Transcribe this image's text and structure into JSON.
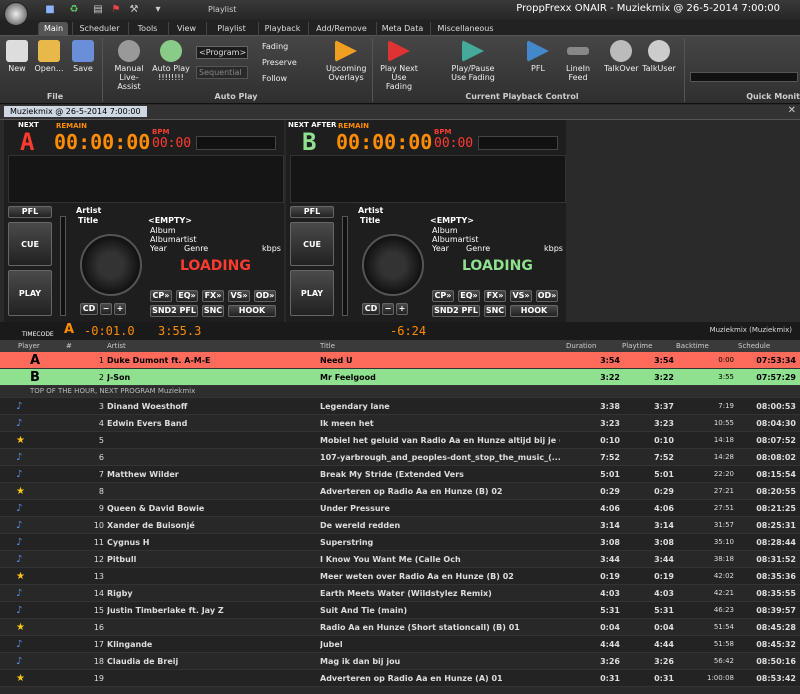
{
  "window": {
    "title": "ProppFrexx ONAIR - Muziekmix @ 26-5-2014 7:00:00",
    "context": "Playlist"
  },
  "tabs": [
    "Main",
    "Scheduler",
    "Tools",
    "View",
    "Playlist",
    "Playback",
    "Add/Remove",
    "Meta Data",
    "Miscellaneous"
  ],
  "ribbon": {
    "file": {
      "new": "New",
      "open": "Open...",
      "save": "Save",
      "group": "File"
    },
    "autoplay": {
      "manual": "Manual Live-Assist",
      "auto": "Auto Play !!!!!!!!",
      "program": "<Program>",
      "sequential": "Sequential",
      "fading": "Fading",
      "preserve": "Preserve",
      "follow": "Follow",
      "upcoming": "Upcoming Overlays",
      "group": "Auto Play"
    },
    "control": {
      "playnext": "Play Next Use Fading",
      "playpause": "Play/Pause Use Fading",
      "pfl": "PFL",
      "linein": "LineIn Feed",
      "talkover": "TalkOver",
      "talkuser": "TalkUser",
      "group": "Current Playback Control"
    },
    "quick": "Quick Monit"
  },
  "doctab": "Muziekmix @ 26-5-2014 7:00:00",
  "decks": [
    {
      "tag": "NEXT",
      "letter": "A",
      "remain": "REMAIN",
      "bpm": "BPM",
      "time": "00:00:00",
      "time2": "00:00",
      "pfl": "PFL",
      "cue": "CUE",
      "play": "PLAY",
      "artist": "Artist",
      "title": "Title",
      "empty": "<EMPTY>",
      "album": "Album",
      "albumartist": "Albumartist",
      "year": "Year",
      "genre": "Genre",
      "kbps": "kbps",
      "status": "LOADING",
      "cd": "CD",
      "pos": "-0:01.0",
      "len": "3:55.3",
      "cp": "CP»",
      "eq": "EQ»",
      "fx": "FX»",
      "vs": "VS»",
      "od": "OD»",
      "snd2": "SND2 PFL",
      "snc": "SNC",
      "hook": "HOOK"
    },
    {
      "tag": "NEXT AFTER",
      "letter": "B",
      "remain": "REMAIN",
      "bpm": "BPM",
      "time": "00:00:00",
      "time2": "00:00",
      "pfl": "PFL",
      "cue": "CUE",
      "play": "PLAY",
      "artist": "Artist",
      "title": "Title",
      "empty": "<EMPTY>",
      "album": "Album",
      "albumartist": "Albumartist",
      "year": "Year",
      "genre": "Genre",
      "kbps": "kbps",
      "status": "LOADING",
      "cd": "CD",
      "pos": "-6:24",
      "cp": "CP»",
      "eq": "EQ»",
      "fx": "FX»",
      "vs": "VS»",
      "od": "OD»",
      "snd2": "SND2 PFL",
      "snc": "SNC",
      "hook": "HOOK"
    }
  ],
  "timecode": "TIMECODE",
  "timecode_letter": "A",
  "playlist_name": "Muziekmix (Muziekmix)",
  "headers": {
    "player": "Player",
    "num": "#",
    "artist": "Artist",
    "title": "Title",
    "duration": "Duration",
    "playtime": "Playtime",
    "backtime": "Backtime",
    "schedule": "Schedule"
  },
  "colors": {
    "deckA": "#ff6b5a",
    "deckB": "#8fe08f",
    "orange": "#ff8c00",
    "red": "#ff3b2f"
  },
  "rows": [
    {
      "player": "A",
      "num": "1",
      "artist": "Duke Dumont ft. A-M-E",
      "title": "Need U",
      "dur": "3:54",
      "play": "3:54",
      "back": "0:00",
      "sched": "07:53:34",
      "type": "a"
    },
    {
      "player": "B",
      "num": "2",
      "artist": "J-Son",
      "title": "Mr Feelgood",
      "dur": "3:22",
      "play": "3:22",
      "back": "3:55",
      "sched": "07:57:29",
      "type": "b"
    },
    {
      "sub": "TOP OF THE HOUR,  NEXT PROGRAM Muziekmix"
    },
    {
      "icon": "note",
      "num": "3",
      "artist": "Dinand Woesthoff",
      "title": "Legendary lane",
      "dur": "3:38",
      "play": "3:37",
      "back": "7:19",
      "sched": "08:00:53"
    },
    {
      "icon": "note",
      "num": "4",
      "artist": "Edwin Evers Band",
      "title": "Ik meen het",
      "dur": "3:23",
      "play": "3:23",
      "back": "10:55",
      "sched": "08:04:30"
    },
    {
      "icon": "star",
      "num": "5",
      "artist": "",
      "title": "Mobiel het geluid van Radio Aa en Hunze altijd bij je (A...",
      "dur": "0:10",
      "play": "0:10",
      "back": "14:18",
      "sched": "08:07:52"
    },
    {
      "icon": "note",
      "num": "6",
      "artist": "",
      "title": "107-yarbrough_and_peoples-dont_stop_the_music_(...",
      "dur": "7:52",
      "play": "7:52",
      "back": "14:28",
      "sched": "08:08:02"
    },
    {
      "icon": "note",
      "num": "7",
      "artist": "Matthew Wilder",
      "title": "Break My Stride (Extended Vers",
      "dur": "5:01",
      "play": "5:01",
      "back": "22:20",
      "sched": "08:15:54"
    },
    {
      "icon": "star",
      "num": "8",
      "artist": "",
      "title": "Adverteren op Radio Aa en Hunze (B) 02",
      "dur": "0:29",
      "play": "0:29",
      "back": "27:21",
      "sched": "08:20:55"
    },
    {
      "icon": "note",
      "num": "9",
      "artist": "Queen & David Bowie",
      "title": "Under Pressure",
      "dur": "4:06",
      "play": "4:06",
      "back": "27:51",
      "sched": "08:21:25"
    },
    {
      "icon": "note",
      "num": "10",
      "artist": "Xander de Buisonjé",
      "title": "De wereld redden",
      "dur": "3:14",
      "play": "3:14",
      "back": "31:57",
      "sched": "08:25:31"
    },
    {
      "icon": "note",
      "num": "11",
      "artist": "Cygnus H",
      "title": "Superstring",
      "dur": "3:08",
      "play": "3:08",
      "back": "35:10",
      "sched": "08:28:44"
    },
    {
      "icon": "note",
      "num": "12",
      "artist": "Pitbull",
      "title": "I Know You Want Me (Calle Och",
      "dur": "3:44",
      "play": "3:44",
      "back": "38:18",
      "sched": "08:31:52"
    },
    {
      "icon": "star",
      "num": "13",
      "artist": "",
      "title": "Meer weten over Radio Aa en Hunze (B) 02",
      "dur": "0:19",
      "play": "0:19",
      "back": "42:02",
      "sched": "08:35:36"
    },
    {
      "icon": "note",
      "num": "14",
      "artist": "Rigby",
      "title": "Earth Meets Water (Wildstylez Remix)",
      "dur": "4:03",
      "play": "4:03",
      "back": "42:21",
      "sched": "08:35:55"
    },
    {
      "icon": "note",
      "num": "15",
      "artist": "Justin Timberlake ft. Jay Z",
      "title": "Suit And Tie (main)",
      "dur": "5:31",
      "play": "5:31",
      "back": "46:23",
      "sched": "08:39:57"
    },
    {
      "icon": "star",
      "num": "16",
      "artist": "",
      "title": "Radio Aa en Hunze (Short stationcall) (B) 01",
      "dur": "0:04",
      "play": "0:04",
      "back": "51:54",
      "sched": "08:45:28"
    },
    {
      "icon": "note",
      "num": "17",
      "artist": "Klingande",
      "title": "Jubel",
      "dur": "4:44",
      "play": "4:44",
      "back": "51:58",
      "sched": "08:45:32"
    },
    {
      "icon": "note",
      "num": "18",
      "artist": "Claudia de Breij",
      "title": "Mag ik dan bij jou",
      "dur": "3:26",
      "play": "3:26",
      "back": "56:42",
      "sched": "08:50:16"
    },
    {
      "icon": "star",
      "num": "19",
      "artist": "",
      "title": "Adverteren op Radio Aa en Hunze (A) 01",
      "dur": "0:31",
      "play": "0:31",
      "back": "1:00:08",
      "sched": "08:53:42"
    }
  ]
}
